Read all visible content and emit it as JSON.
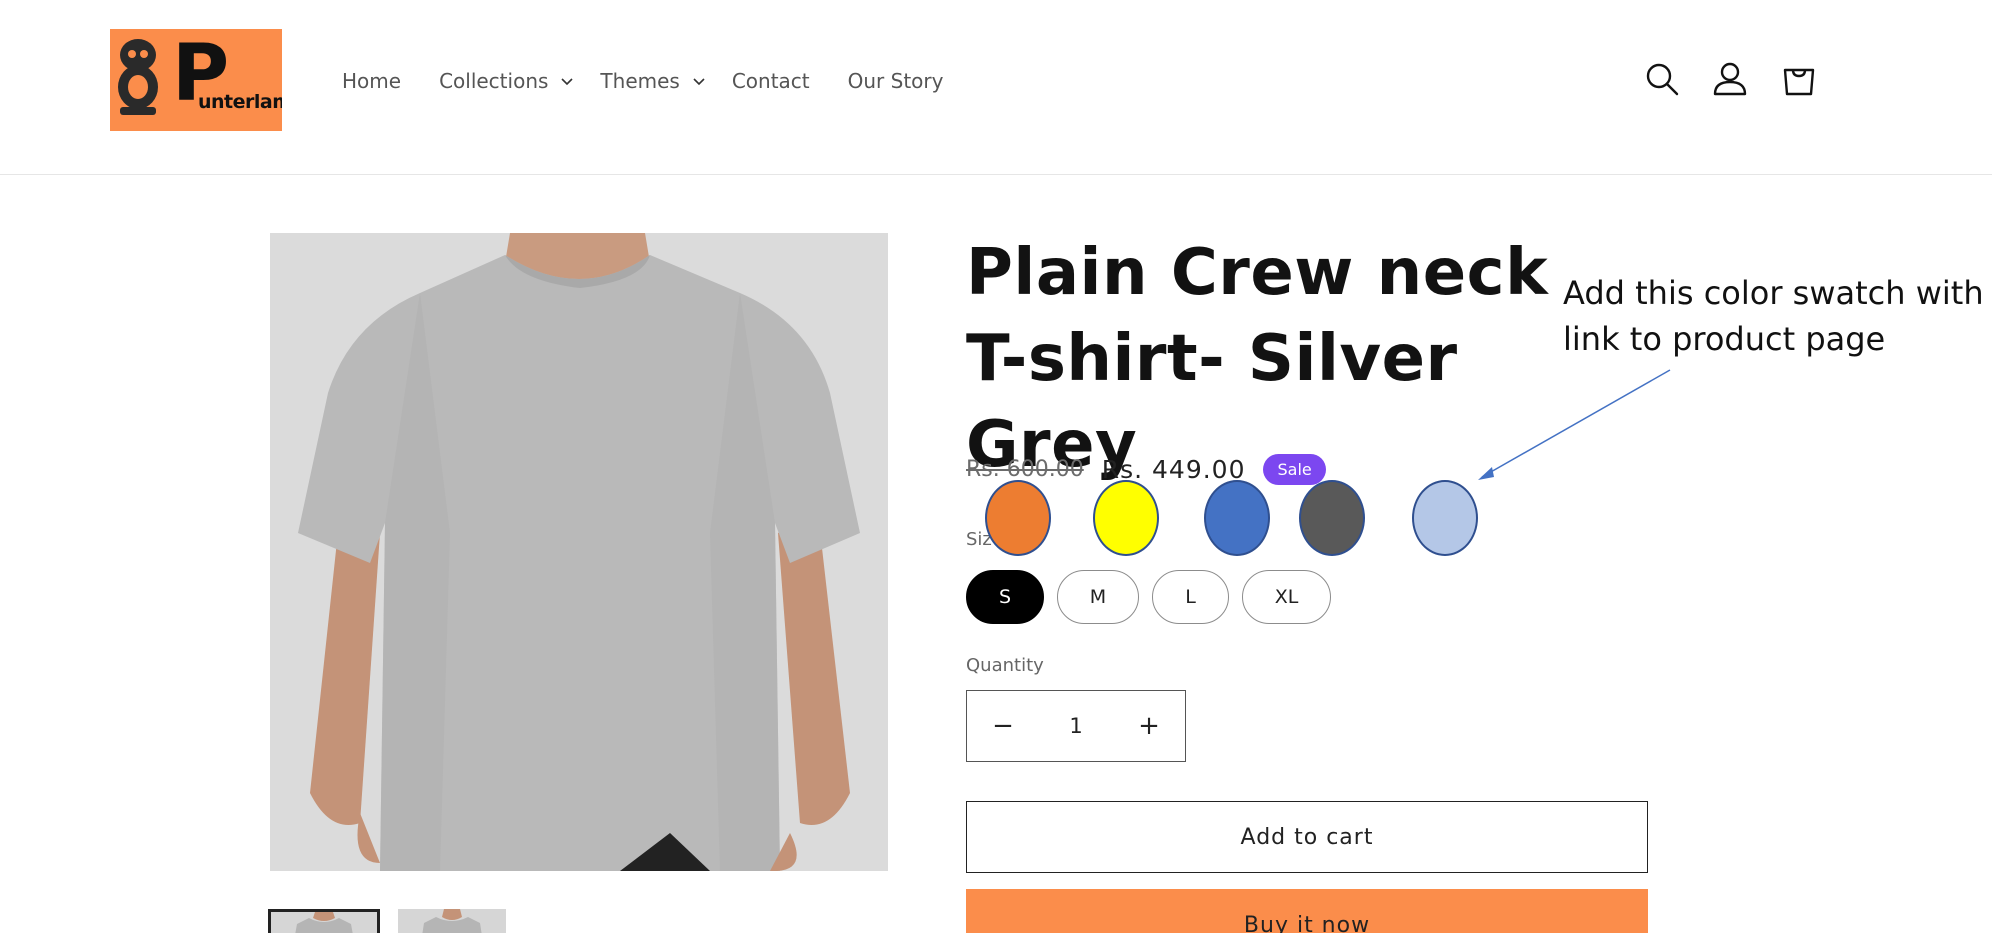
{
  "header": {
    "logo_text": "unterlama",
    "logo_letter": "P",
    "nav": [
      {
        "label": "Home",
        "has_dropdown": false
      },
      {
        "label": "Collections",
        "has_dropdown": true
      },
      {
        "label": "Themes",
        "has_dropdown": true
      },
      {
        "label": "Contact",
        "has_dropdown": false
      },
      {
        "label": "Our Story",
        "has_dropdown": false
      }
    ],
    "icons": [
      "search-icon",
      "account-icon",
      "cart-icon"
    ]
  },
  "product": {
    "title": "Plain Crew neck T-shirt- Silver Grey",
    "price_regular": "Rs. 600.00",
    "price_sale": "Rs. 449.00",
    "badge": "Sale",
    "size_label": "Size",
    "sizes": [
      "S",
      "M",
      "L",
      "XL"
    ],
    "selected_size": "S",
    "quantity_label": "Quantity",
    "quantity": "1",
    "qty_minus": "−",
    "qty_plus": "+",
    "add_to_cart": "Add to cart",
    "buy_now": "Buy it now"
  },
  "swatches": [
    {
      "color": "#ed7d31"
    },
    {
      "color": "#ffff00"
    },
    {
      "color": "#4472c4"
    },
    {
      "color": "#595959"
    },
    {
      "color": "#b4c7e7"
    }
  ],
  "annotation": {
    "text": "Add this color swatch with link to product page"
  },
  "colors": {
    "brand_orange": "#fb8d4b",
    "sale_badge": "#7c47f0",
    "arrow": "#4472c4"
  }
}
